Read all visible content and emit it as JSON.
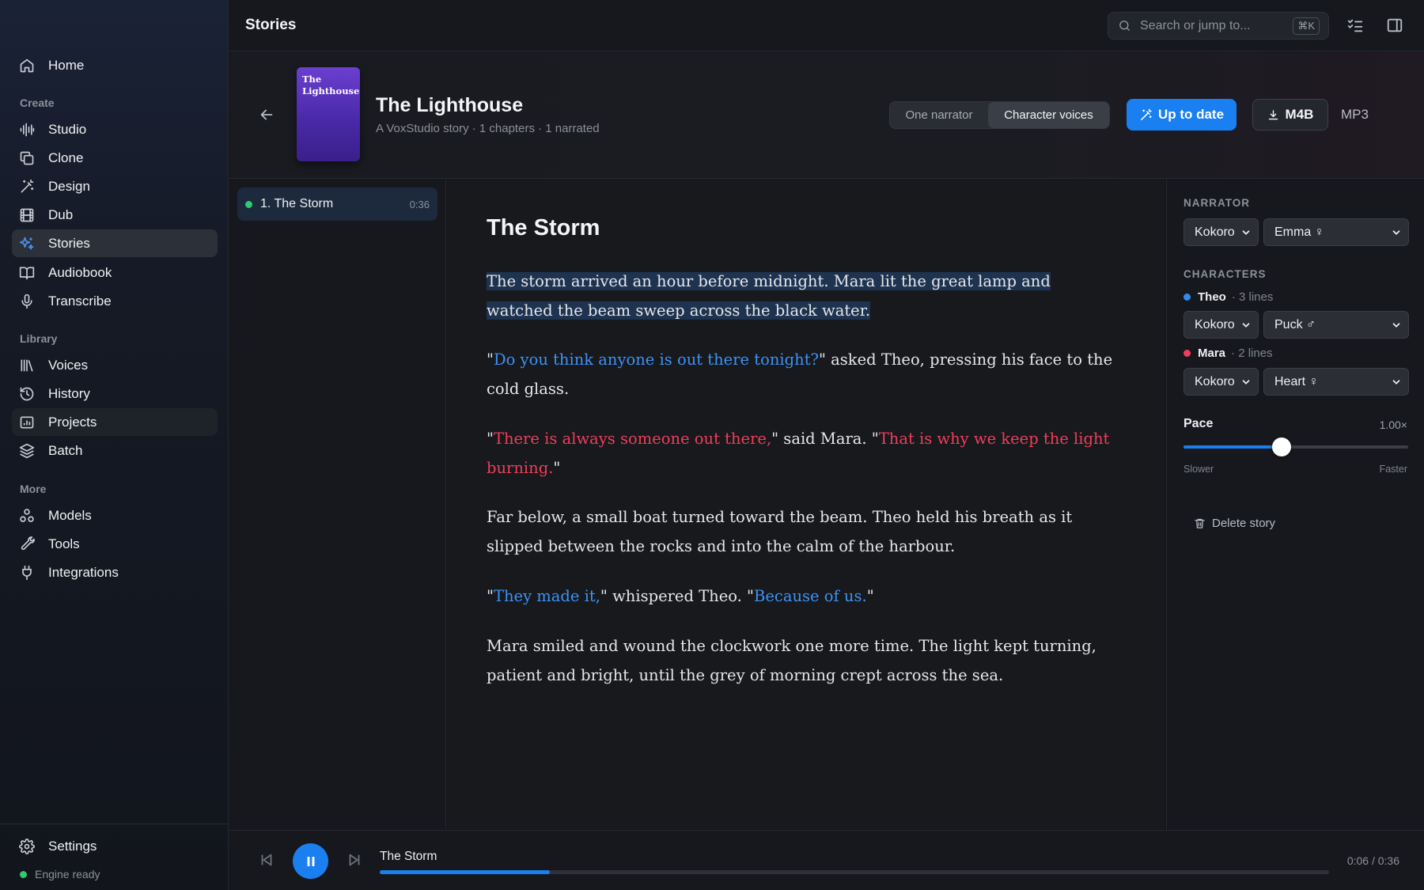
{
  "sidebar": {
    "home": "Home",
    "sections": {
      "create": "Create",
      "library": "Library",
      "more": "More"
    },
    "create_items": [
      "Studio",
      "Clone",
      "Design",
      "Dub",
      "Stories",
      "Audiobook",
      "Transcribe"
    ],
    "library_items": [
      "Voices",
      "History",
      "Projects",
      "Batch"
    ],
    "more_items": [
      "Models",
      "Tools",
      "Integrations"
    ],
    "active_item": "Stories",
    "settings": "Settings",
    "engine_status": "Engine ready",
    "accent_color": "#4a90f0"
  },
  "topbar": {
    "title": "Stories",
    "search_placeholder": "Search or jump to...",
    "search_shortcut": "⌘K"
  },
  "story": {
    "cover_title": "The Lighthouse",
    "title": "The Lighthouse",
    "subtitle": "A VoxStudio story · 1 chapters · 1 narrated",
    "modes": [
      "One narrator",
      "Character voices"
    ],
    "selected_mode": "Character voices",
    "status_button": "Up to date",
    "export_m4b": "M4B",
    "export_mp3": "MP3"
  },
  "chapters": [
    {
      "label": "1. The Storm",
      "duration": "0:36",
      "status": "narrated"
    }
  ],
  "reader": {
    "chapter_title": "The Storm",
    "p1": "The storm arrived an hour before midnight. Mara lit the great lamp and watched the beam sweep across the black water.",
    "p2": {
      "q_open": "\"",
      "theo_1": "Do you think anyone is out there tonight?",
      "rest": "\" asked Theo, pressing his face to the cold glass."
    },
    "p3": {
      "q_open": "\"",
      "mara_1": "There is always someone out there,",
      "mid": "\" said Mara. \"",
      "mara_2": "That is why we keep the light burning.",
      "q_close": "\""
    },
    "p4": "Far below, a small boat turned toward the beam. Theo held his breath as it slipped between the rocks and into the calm of the harbour.",
    "p5": {
      "q_open": "\"",
      "theo_1": "They made it,",
      "mid": "\" whispered Theo. \"",
      "theo_2": "Because of us.",
      "q_close": "\""
    },
    "p6": "Mara smiled and wound the clockwork one more time. The light kept turning, patient and bright, until the grey of morning crept across the sea."
  },
  "panel": {
    "narrator_label": "NARRATOR",
    "narrator_engine": "Kokoro",
    "narrator_voice": "Emma ♀",
    "characters_label": "CHARACTERS",
    "characters": [
      {
        "name": "Theo",
        "lines": "· 3 lines",
        "engine": "Kokoro",
        "voice": "Puck ♂",
        "color": "#2d8cf0"
      },
      {
        "name": "Mara",
        "lines": "· 2 lines",
        "engine": "Kokoro",
        "voice": "Heart ♀",
        "color": "#f03e5b"
      }
    ],
    "pace_label": "Pace",
    "pace_value": "1.00×",
    "pace_level": 0.437,
    "pace_min_label": "Slower",
    "pace_max_label": "Faster",
    "delete_label": "Delete story"
  },
  "player": {
    "track_title": "The Storm",
    "time": "0:06 / 0:36",
    "progress": 0.1789
  }
}
